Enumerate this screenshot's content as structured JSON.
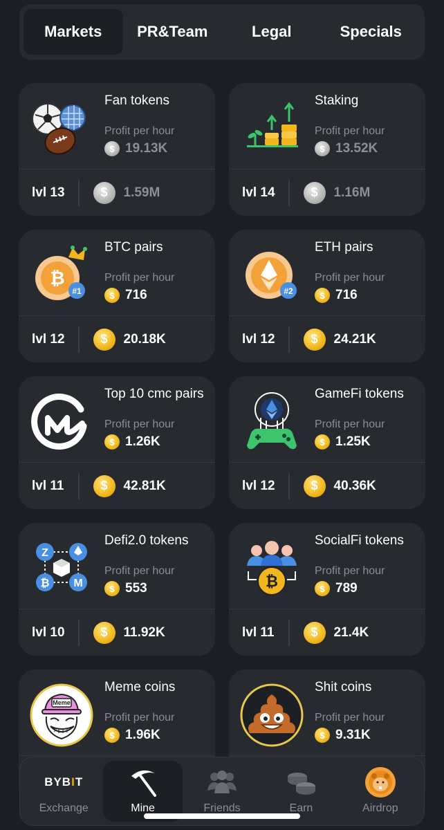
{
  "tabs": [
    {
      "label": "Markets",
      "active": true
    },
    {
      "label": "PR&Team",
      "active": false
    },
    {
      "label": "Legal",
      "active": false
    },
    {
      "label": "Specials",
      "active": false
    }
  ],
  "profit_label": "Profit per hour",
  "cards": [
    {
      "name": "Fan tokens",
      "profit": "19.13K",
      "level": "lvl 13",
      "cost": "1.59M",
      "locked": true,
      "icon": "sports-balls-icon"
    },
    {
      "name": "Staking",
      "profit": "13.52K",
      "level": "lvl 14",
      "cost": "1.16M",
      "locked": true,
      "icon": "staking-growth-icon"
    },
    {
      "name": "BTC pairs",
      "profit": "716",
      "level": "lvl 12",
      "cost": "20.18K",
      "locked": false,
      "icon": "btc-crown-coin-icon",
      "badge": "#1"
    },
    {
      "name": "ETH pairs",
      "profit": "716",
      "level": "lvl 12",
      "cost": "24.21K",
      "locked": false,
      "icon": "eth-coin-icon",
      "badge": "#2"
    },
    {
      "name": "Top 10 cmc pairs",
      "profit": "1.26K",
      "level": "lvl 11",
      "cost": "42.81K",
      "locked": false,
      "icon": "coinmarketcap-logo-icon"
    },
    {
      "name": "GameFi tokens",
      "profit": "1.25K",
      "level": "lvl 12",
      "cost": "40.36K",
      "locked": false,
      "icon": "gamepad-eth-icon"
    },
    {
      "name": "Defi2.0 tokens",
      "profit": "553",
      "level": "lvl 10",
      "cost": "11.92K",
      "locked": false,
      "icon": "defi-network-icon"
    },
    {
      "name": "SocialFi tokens",
      "profit": "789",
      "level": "lvl 11",
      "cost": "21.4K",
      "locked": false,
      "icon": "socialfi-people-btc-icon"
    },
    {
      "name": "Meme coins",
      "profit": "1.96K",
      "level": "",
      "cost": "",
      "locked": false,
      "icon": "trollface-meme-icon",
      "meme_text": "Meme"
    },
    {
      "name": "Shit coins",
      "profit": "9.31K",
      "level": "",
      "cost": "",
      "locked": false,
      "icon": "poop-emoji-icon"
    }
  ],
  "nav": [
    {
      "label": "Exchange",
      "icon": "bybit-logo-icon",
      "active": false,
      "logo_a": "BYB",
      "logo_b": "I",
      "logo_c": "T"
    },
    {
      "label": "Mine",
      "icon": "pickaxe-icon",
      "active": true
    },
    {
      "label": "Friends",
      "icon": "friends-group-icon",
      "active": false
    },
    {
      "label": "Earn",
      "icon": "coins-stack-icon",
      "active": false
    },
    {
      "label": "Airdrop",
      "icon": "hamster-coin-icon",
      "active": false
    }
  ],
  "colors": {
    "background": "#1c1f24",
    "card": "#272a2f",
    "coin": "#f3b71d",
    "muted": "#8b8f96"
  }
}
